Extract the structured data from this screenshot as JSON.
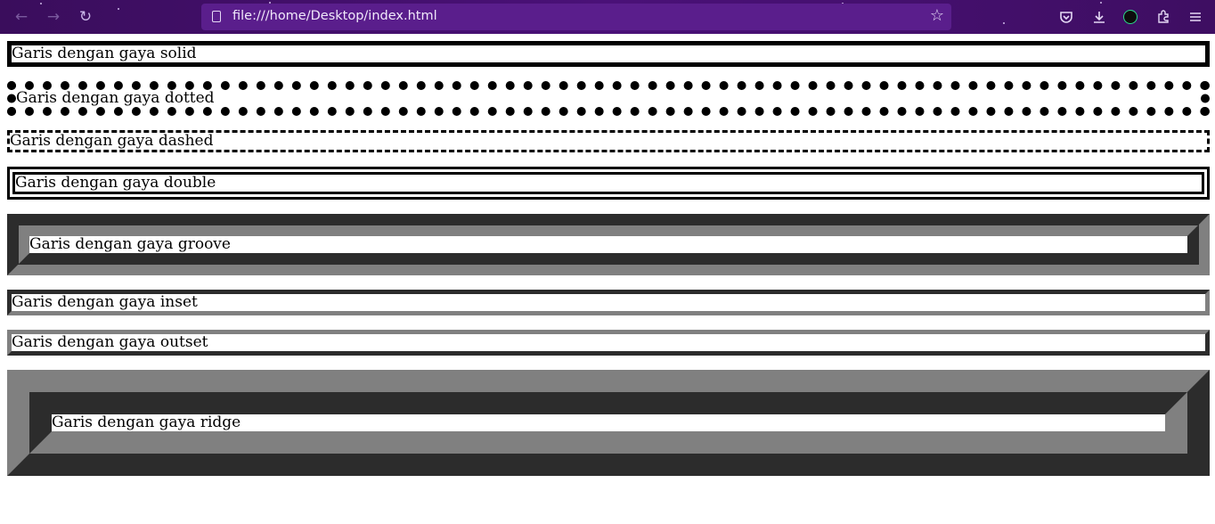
{
  "browser": {
    "url": "file:///home/Desktop/index.html",
    "back_icon": "arrow-left-icon",
    "forward_icon": "arrow-right-icon",
    "reload_icon": "reload-icon",
    "bookmark_icon": "star-icon",
    "toolbar_icons": [
      "pocket-icon",
      "download-icon",
      "extension-icon",
      "puzzle-icon",
      "menu-icon"
    ],
    "accent": "#4a1178"
  },
  "page": {
    "lines": [
      {
        "style": "solid",
        "text": "Garis dengan gaya solid"
      },
      {
        "style": "dotted",
        "text": "Garis dengan gaya dotted"
      },
      {
        "style": "dashed",
        "text": "Garis dengan gaya dashed"
      },
      {
        "style": "double",
        "text": "Garis dengan gaya double"
      },
      {
        "style": "groove",
        "text": "Garis dengan gaya groove"
      },
      {
        "style": "inset",
        "text": "Garis dengan gaya inset"
      },
      {
        "style": "outset",
        "text": "Garis dengan gaya outset"
      },
      {
        "style": "ridge",
        "text": "Garis dengan gaya ridge"
      }
    ]
  }
}
